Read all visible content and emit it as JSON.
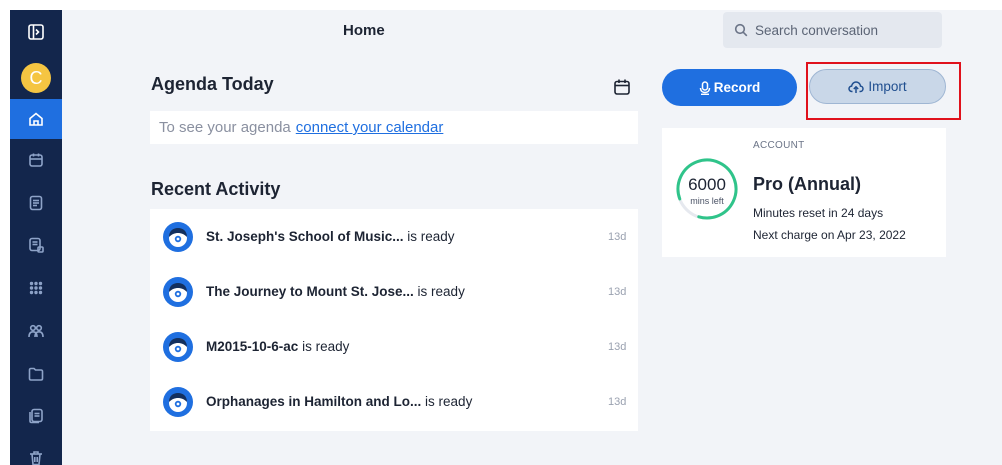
{
  "header": {
    "title": "Home",
    "search_placeholder": "Search conversation"
  },
  "sidebar": {
    "avatar_letter": "C",
    "items": [
      {
        "name": "home",
        "icon": "home-icon",
        "active": true
      },
      {
        "name": "calendar",
        "icon": "calendar-icon"
      },
      {
        "name": "notes",
        "icon": "notes-icon"
      },
      {
        "name": "shared",
        "icon": "shared-notes-icon"
      },
      {
        "name": "apps",
        "icon": "apps-grid-icon"
      },
      {
        "name": "people",
        "icon": "people-icon"
      },
      {
        "name": "folders",
        "icon": "folder-icon"
      },
      {
        "name": "import",
        "icon": "document-icon"
      },
      {
        "name": "trash",
        "icon": "trash-icon"
      }
    ]
  },
  "agenda": {
    "title": "Agenda Today",
    "prompt_prefix": "To see your agenda",
    "prompt_link": "connect your calendar"
  },
  "recent": {
    "title": "Recent Activity",
    "items": [
      {
        "title": "St. Joseph's School of Music...",
        "status": "is ready",
        "age": "13d"
      },
      {
        "title": "The Journey to Mount St. Jose...",
        "status": "is ready",
        "age": "13d"
      },
      {
        "title": "M2015-10-6-ac",
        "status": "is ready",
        "age": "13d"
      },
      {
        "title": "Orphanages in Hamilton and Lo...",
        "status": "is ready",
        "age": "13d"
      }
    ]
  },
  "actions": {
    "record_label": "Record",
    "import_label": "Import"
  },
  "account": {
    "section_label": "ACCOUNT",
    "minutes": "6000",
    "minutes_label": "mins left",
    "minutes_fraction": 0.85,
    "plan": "Pro (Annual)",
    "reset_text": "Minutes reset in 24 days",
    "charge_text": "Next charge on Apr 23, 2022"
  },
  "colors": {
    "sidebar_bg": "#13264c",
    "accent": "#1f6fe0",
    "ring": "#2fc48a",
    "highlight": "#e0111c"
  }
}
